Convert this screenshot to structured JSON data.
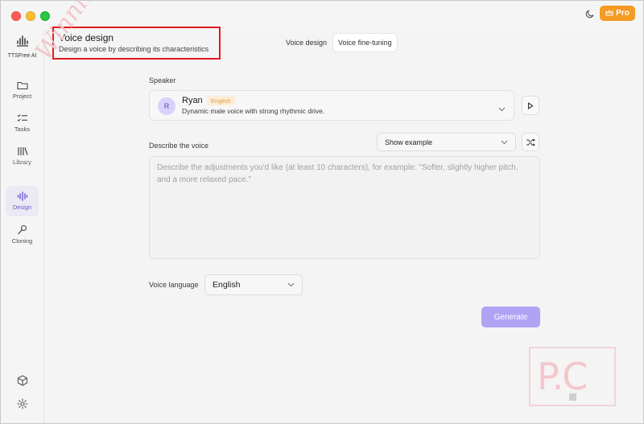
{
  "app": {
    "name": "TTSFree AI",
    "pro_label": "Pro"
  },
  "sidebar": {
    "items": [
      {
        "label": "Project"
      },
      {
        "label": "Tasks"
      },
      {
        "label": "Library"
      },
      {
        "label": "Design"
      },
      {
        "label": "Cloning"
      }
    ]
  },
  "header": {
    "title": "Voice design",
    "subtitle": "Design a voice by describing its characteristics"
  },
  "tabs": [
    {
      "label": "Voice design",
      "active": false
    },
    {
      "label": "Voice fine-tuning",
      "active": true
    }
  ],
  "speaker": {
    "section_label": "Speaker",
    "avatar_initial": "R",
    "name": "Ryan",
    "language_badge": "English",
    "description": "Dynamic male voice with strong rhythmic drive."
  },
  "describe": {
    "section_label": "Describe the voice",
    "example_select": "Show example",
    "placeholder": "Describe the adjustments you'd like (at least 10 characters), for example: \"Softer, slightly higher pitch, and a more relaxed pace.\""
  },
  "language": {
    "label": "Voice language",
    "value": "English"
  },
  "actions": {
    "generate_label": "Generate"
  },
  "watermark": {
    "text": "P.C",
    "diagonal_text": "WinningPC"
  },
  "colors": {
    "accent": "#6a55d6",
    "generate_bg": "#b1a2f3",
    "pro_bg": "#f59a23",
    "highlight_border": "#e01d1d"
  }
}
